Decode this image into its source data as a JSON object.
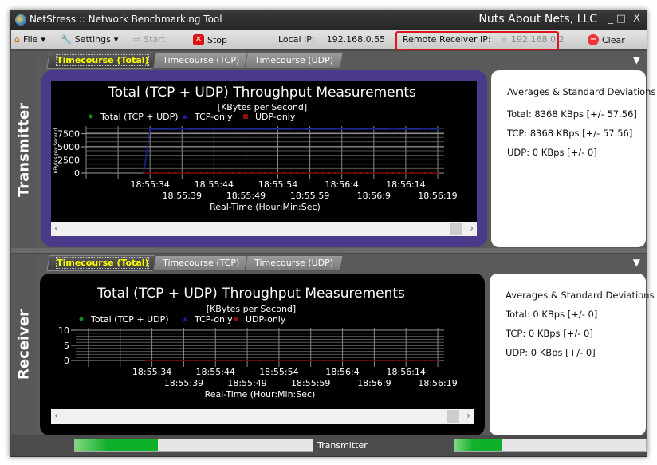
{
  "window": {
    "title": "NetStress :: Network Benchmarking Tool",
    "brand": "Nuts About Nets, LLC",
    "min": "_",
    "max": "□",
    "close": "X"
  },
  "toolbar": {
    "file": "File",
    "settings": "Settings",
    "start": "Start",
    "stop": "Stop",
    "local_ip_label": "Local IP:",
    "local_ip": "192.168.0.55",
    "remote_ip_label": "Remote Receiver IP:",
    "remote_ip": "192.168.0.2",
    "clear": "Clear"
  },
  "tabs": [
    "Timecourse (Total)",
    "Timecourse (TCP)",
    "Timecourse (UDP)"
  ],
  "transmitter": {
    "label": "Transmitter",
    "stats": {
      "title": "Averages & Standard Deviations",
      "total": "Total: 8368 KBps [+/-  57.56]",
      "tcp": "TCP:  8368 KBps [+/-  57.56]",
      "udp": "UDP:  0 KBps [+/-  0]"
    }
  },
  "receiver": {
    "label": "Receiver",
    "stats": {
      "title": "Averages & Standard Deviations",
      "total": "Total: 0 KBps [+/-  0]",
      "tcp": "TCP:  0 KBps [+/-  0]",
      "udp": "UDP:  0 KBps [+/-  0]"
    }
  },
  "status": {
    "label": "Transmitter",
    "progress_left": 0.35,
    "progress_right": 0.25
  },
  "colors": {
    "total": "#1a8a1a",
    "tcp": "#1a1aa0",
    "udp": "#8a1010",
    "panel_accent": "#4b3a8a"
  },
  "chart_data": [
    {
      "type": "line",
      "title": "Total (TCP + UDP) Throughput Measurements",
      "subtitle": "[KBytes per Second]",
      "ylabel": "KBytes per Second",
      "xlabel": "Real-Time (Hour:Min:Sec)",
      "ylim": [
        0,
        8500
      ],
      "yticks": [
        0,
        2500,
        5000,
        7500
      ],
      "xlim": [
        "18:55:24",
        "18:56:20"
      ],
      "xticks_row1": [
        "18:55:34",
        "18:55:44",
        "18:55:54",
        "18:56:4",
        "18:56:14"
      ],
      "xticks_row2": [
        "18:55:39",
        "18:55:49",
        "18:55:59",
        "18:56:9",
        "18:56:19"
      ],
      "legend": [
        "Total (TCP + UDP)",
        "TCP-only",
        "UDP-only"
      ],
      "grid": true,
      "start": "18:55:33",
      "series": [
        {
          "name": "Total (TCP + UDP)",
          "values": [
            0,
            8380,
            8360,
            8350,
            8370,
            8360,
            8420,
            8350,
            8360,
            8370,
            8350,
            8360,
            8370,
            8380,
            8360,
            8350,
            8360,
            8370,
            8360,
            8380,
            8360,
            8350,
            8370,
            8360,
            8400,
            8360,
            8350,
            8370,
            8360,
            8350,
            8370,
            8390,
            8360,
            8380,
            8360,
            8370,
            8380,
            8360,
            8350,
            8420,
            8370,
            8360,
            8340,
            8360,
            8380,
            8370,
            8360
          ]
        },
        {
          "name": "TCP-only",
          "values": [
            0,
            8380,
            8360,
            8350,
            8370,
            8360,
            8420,
            8350,
            8360,
            8370,
            8350,
            8360,
            8370,
            8380,
            8360,
            8350,
            8360,
            8370,
            8360,
            8380,
            8360,
            8350,
            8370,
            8360,
            8400,
            8360,
            8350,
            8370,
            8360,
            8350,
            8370,
            8390,
            8360,
            8380,
            8360,
            8370,
            8380,
            8360,
            8350,
            8420,
            8370,
            8360,
            8340,
            8360,
            8380,
            8370,
            8360
          ]
        },
        {
          "name": "UDP-only",
          "values": [
            0,
            0,
            0,
            0,
            0,
            0,
            0,
            0,
            0,
            0,
            0,
            0,
            0,
            0,
            0,
            0,
            0,
            0,
            0,
            0,
            0,
            0,
            0,
            0,
            0,
            0,
            0,
            0,
            0,
            0,
            0,
            0,
            0,
            0,
            0,
            0,
            0,
            0,
            0,
            0,
            0,
            0,
            0,
            0,
            0,
            0,
            0
          ]
        }
      ]
    },
    {
      "type": "line",
      "title": "Total (TCP + UDP) Throughput Measurements",
      "subtitle": "[KBytes per Second]",
      "xlabel": "Real-Time (Hour:Min:Sec)",
      "ylim": [
        0,
        10
      ],
      "yticks": [
        0,
        5,
        10
      ],
      "xlim": [
        "18:55:22",
        "18:56:20"
      ],
      "xticks_row1": [
        "18:55:34",
        "18:55:44",
        "18:55:54",
        "18:56:4",
        "18:56:14"
      ],
      "xticks_row2": [
        "18:55:39",
        "18:55:49",
        "18:55:59",
        "18:56:9",
        "18:56:19"
      ],
      "legend": [
        "Total (TCP + UDP)",
        "TCP-only",
        "UDP-only"
      ],
      "grid": true,
      "start": "18:55:33",
      "series": [
        {
          "name": "UDP-only",
          "values": [
            0,
            0,
            0,
            0,
            0,
            0,
            0,
            0,
            0,
            0,
            0,
            0,
            0,
            0,
            0,
            0,
            0,
            0,
            0,
            0,
            0,
            0,
            0,
            0,
            0,
            0,
            0,
            0,
            0,
            0,
            0,
            0,
            0,
            0,
            0,
            0,
            0,
            0,
            0,
            0,
            0,
            0,
            0,
            0,
            0,
            0,
            0
          ]
        }
      ]
    }
  ]
}
